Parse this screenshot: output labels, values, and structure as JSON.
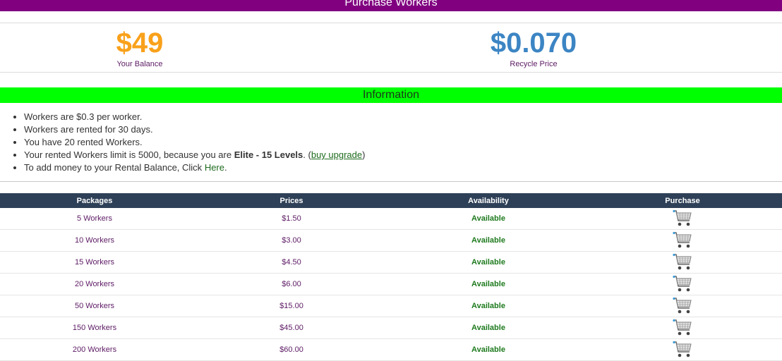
{
  "page": {
    "title": "Purchase Workers"
  },
  "stats": {
    "balance": {
      "value": "$49",
      "label": "Your Balance"
    },
    "recycle": {
      "value": "$0.070",
      "label": "Recycle Price"
    }
  },
  "info": {
    "header": "Information",
    "items": {
      "price_per_worker": "Workers are $0.3 per worker.",
      "rent_duration": "Workers are rented for 30 days.",
      "rented_count": "You have 20 rented Workers.",
      "limit_prefix": "Your rented Workers limit is 5000, because you are ",
      "limit_level": "Elite - 15 Levels",
      "limit_mid": ". (",
      "upgrade_link": "buy upgrade",
      "limit_suffix": ")",
      "add_money_prefix": "To add money to your Rental Balance, Click ",
      "add_money_link": "Here",
      "add_money_suffix": "."
    }
  },
  "table": {
    "headers": {
      "packages": "Packages",
      "prices": "Prices",
      "availability": "Availability",
      "purchase": "Purchase"
    },
    "rows": [
      {
        "package": "5 Workers",
        "price": "$1.50",
        "availability": "Available"
      },
      {
        "package": "10 Workers",
        "price": "$3.00",
        "availability": "Available"
      },
      {
        "package": "15 Workers",
        "price": "$4.50",
        "availability": "Available"
      },
      {
        "package": "20 Workers",
        "price": "$6.00",
        "availability": "Available"
      },
      {
        "package": "50 Workers",
        "price": "$15.00",
        "availability": "Available"
      },
      {
        "package": "150 Workers",
        "price": "$45.00",
        "availability": "Available"
      },
      {
        "package": "200 Workers",
        "price": "$60.00",
        "availability": "Available"
      }
    ],
    "purchase_icon": "shopping-cart-icon"
  },
  "colors": {
    "title_bar": "#800080",
    "info_bar": "#00ff00",
    "balance": "#f9a11b",
    "recycle": "#3c85c4",
    "table_header": "#2e4057",
    "available": "#1e7a1e"
  }
}
